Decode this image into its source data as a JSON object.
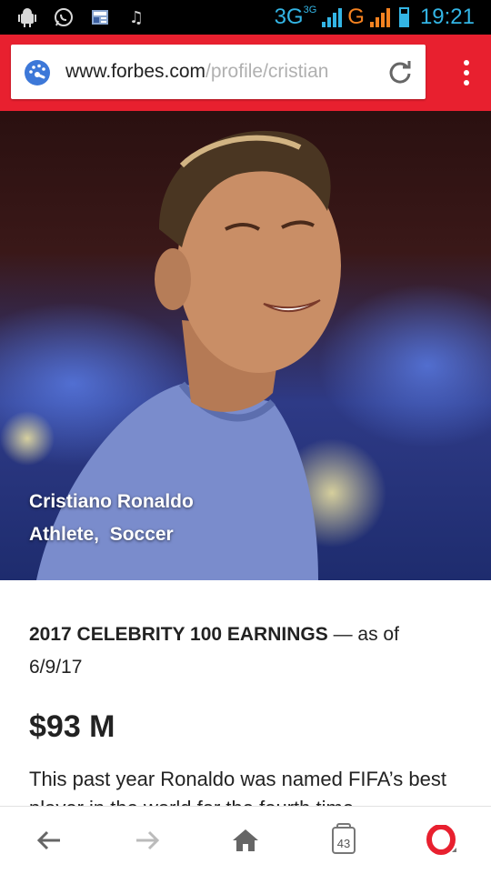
{
  "status_bar": {
    "icons": [
      "android-debug-icon",
      "whatsapp-icon",
      "news-icon",
      "music-note-icon"
    ],
    "network_1": "3G",
    "network_1_small": "3G",
    "network_2": "G",
    "time": "19:21"
  },
  "browser": {
    "url_domain": "www.forbes.com",
    "url_path": "/profile/cristian",
    "tab_count": "43"
  },
  "profile": {
    "name": "Cristiano Ronaldo",
    "occupation": "Athlete,",
    "sport": "Soccer",
    "earnings_heading": "2017 CELEBRITY 100 EARNINGS",
    "earnings_dash": " — as of",
    "earnings_date": "6/9/17",
    "earnings_value": "$93 M",
    "description": "This past year Ronaldo was named FIFA’s best player in the world for the fourth time"
  },
  "colors": {
    "toolbar": "#e8202f",
    "status_accent": "#33b5e5",
    "opera_red": "#e8202f"
  }
}
